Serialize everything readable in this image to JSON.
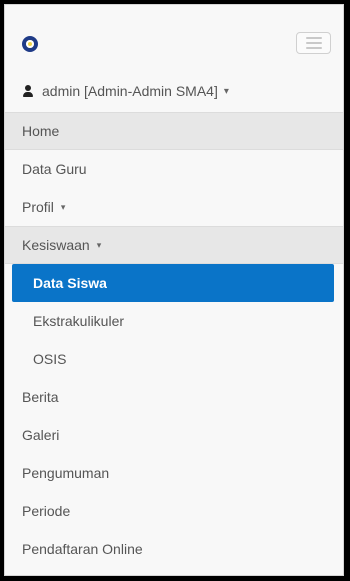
{
  "header": {
    "logo_icon": "school-logo-icon",
    "menu_icon": "hamburger-menu-icon",
    "user": {
      "icon": "user-icon",
      "label": "admin [Admin-Admin SMA4]",
      "caret": "▾"
    }
  },
  "nav": {
    "items": [
      {
        "label": "Home",
        "highlighted": true
      },
      {
        "label": "Data Guru"
      },
      {
        "label": "Profil",
        "caret": "▾"
      },
      {
        "label": "Kesiswaan",
        "caret": "▾",
        "highlighted": true
      }
    ],
    "subitems": [
      {
        "label": "Data Siswa",
        "active": true
      },
      {
        "label": "Ekstrakulikuler"
      },
      {
        "label": "OSIS"
      }
    ],
    "more_items": [
      {
        "label": "Berita"
      },
      {
        "label": "Galeri"
      },
      {
        "label": "Pengumuman"
      },
      {
        "label": "Periode"
      },
      {
        "label": "Pendaftaran Online"
      }
    ]
  },
  "colors": {
    "active_bg": "#0a74c8",
    "highlight_bg": "#e7e7e7",
    "text": "#555555"
  }
}
